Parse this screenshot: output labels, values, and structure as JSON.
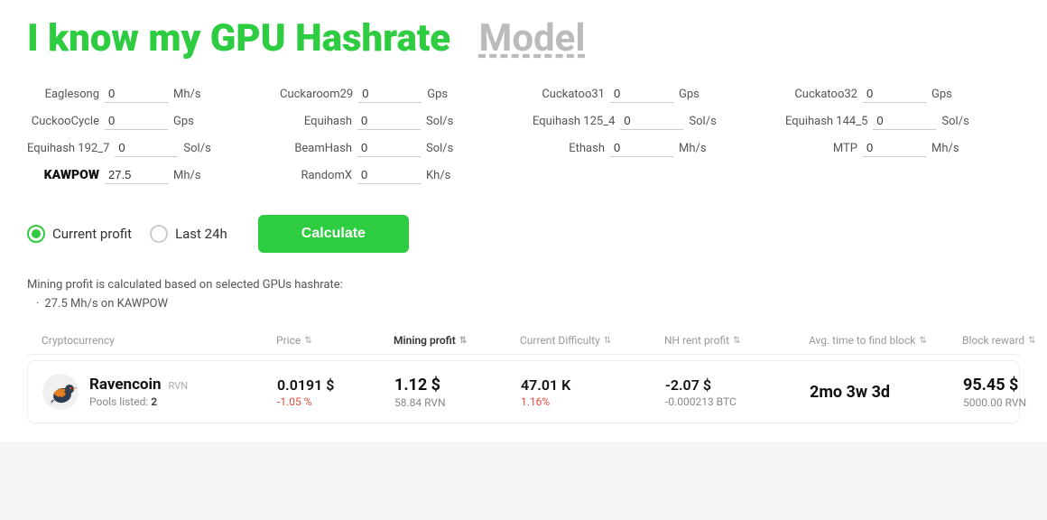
{
  "title": {
    "prefix": "I know my GPU Hashrate",
    "highlight": "Model"
  },
  "hashrates": [
    {
      "label": "Eaglesong",
      "value": "0",
      "unit": "Mh/s",
      "bold": false
    },
    {
      "label": "Cuckaroom29",
      "value": "0",
      "unit": "Gps",
      "bold": false
    },
    {
      "label": "Cuckatoo31",
      "value": "0",
      "unit": "Gps",
      "bold": false
    },
    {
      "label": "Cuckatoo32",
      "value": "0",
      "unit": "Gps",
      "bold": false
    },
    {
      "label": "CuckooCycle",
      "value": "0",
      "unit": "Gps",
      "bold": false
    },
    {
      "label": "Equihash",
      "value": "0",
      "unit": "Sol/s",
      "bold": false
    },
    {
      "label": "Equihash 125_4",
      "value": "0",
      "unit": "Sol/s",
      "bold": false
    },
    {
      "label": "Equihash 144_5",
      "value": "0",
      "unit": "Sol/s",
      "bold": false
    },
    {
      "label": "Equihash 192_7",
      "value": "0",
      "unit": "Sol/s",
      "bold": false
    },
    {
      "label": "BeamHash",
      "value": "0",
      "unit": "Sol/s",
      "bold": false
    },
    {
      "label": "Ethash",
      "value": "0",
      "unit": "Mh/s",
      "bold": false
    },
    {
      "label": "MTP",
      "value": "0",
      "unit": "Mh/s",
      "bold": false
    },
    {
      "label": "KAWPOW",
      "value": "27.5",
      "unit": "Mh/s",
      "bold": true
    },
    {
      "label": "RandomX",
      "value": "0",
      "unit": "Kh/s",
      "bold": false
    }
  ],
  "controls": {
    "option1": "Current profit",
    "option2": "Last 24h",
    "calculate": "Calculate"
  },
  "info": {
    "text": "Mining profit is calculated based on selected GPUs hashrate:",
    "summary": "27.5 Mh/s on KAWPOW"
  },
  "table": {
    "headers": [
      {
        "label": "Cryptocurrency",
        "active": false,
        "sort": false
      },
      {
        "label": "Price",
        "active": false,
        "sort": true
      },
      {
        "label": "Mining profit",
        "active": true,
        "sort": true
      },
      {
        "label": "Current Difficulty",
        "active": false,
        "sort": true
      },
      {
        "label": "NH rent profit",
        "active": false,
        "sort": true
      },
      {
        "label": "Avg. time to find block",
        "active": false,
        "sort": true
      },
      {
        "label": "Block reward",
        "active": false,
        "sort": true
      }
    ],
    "rows": [
      {
        "coin_name": "Ravencoin",
        "coin_ticker": "RVN",
        "pools_label": "Pools listed:",
        "pools_count": "2",
        "price": "0.0191 $",
        "price_change": "-1.05 %",
        "profit_main": "1.12 $",
        "profit_sub": "58.84 RVN",
        "difficulty": "47.01 K",
        "diff_change": "1.16%",
        "nh_main": "-2.07 $",
        "nh_sub": "-0.000213 BTC",
        "time_main": "2mo 3w 3d",
        "reward_main": "95.45 $",
        "reward_sub": "5000.00 RVN"
      }
    ]
  }
}
